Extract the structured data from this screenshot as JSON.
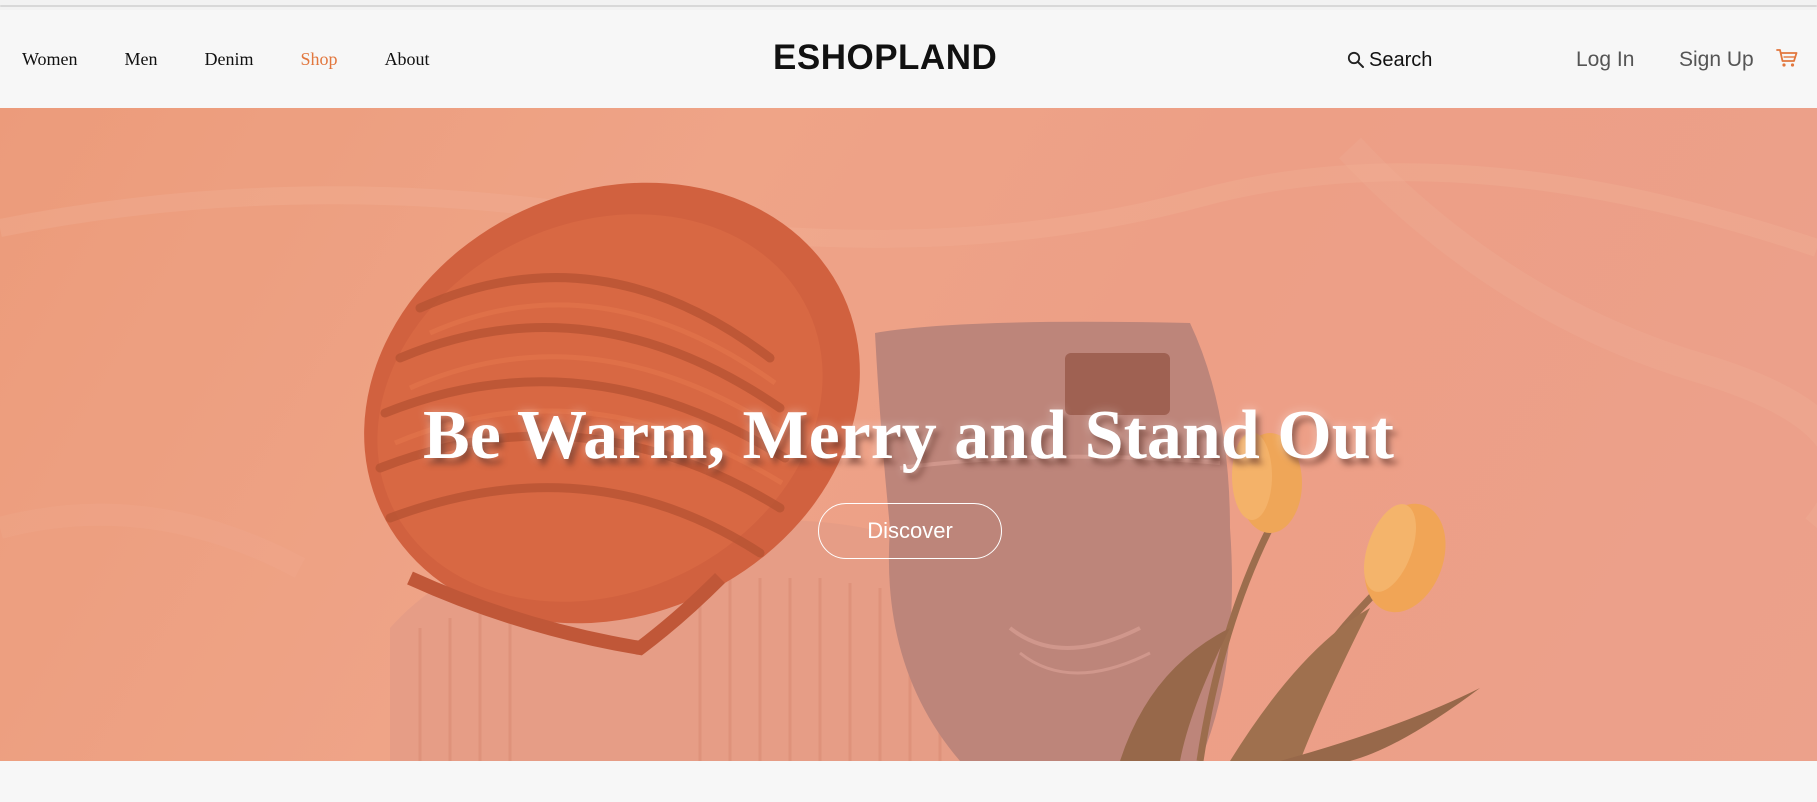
{
  "nav": {
    "items": [
      {
        "label": "Women"
      },
      {
        "label": "Men"
      },
      {
        "label": "Denim"
      },
      {
        "label": "Shop",
        "active": true
      },
      {
        "label": "About"
      }
    ]
  },
  "brand": {
    "name": "ESHOPLAND"
  },
  "search": {
    "label": "Search",
    "icon": "search-icon"
  },
  "auth": {
    "login_label": "Log In",
    "signup_label": "Sign Up"
  },
  "cart": {
    "icon": "cart-icon",
    "color": "#e2773e"
  },
  "hero": {
    "title": "Be Warm, Merry and Stand Out",
    "cta_label": "Discover"
  },
  "colors": {
    "accent": "#e2773e",
    "hero_overlay": "#ee9d80",
    "text": "#111111",
    "muted": "#555555"
  }
}
